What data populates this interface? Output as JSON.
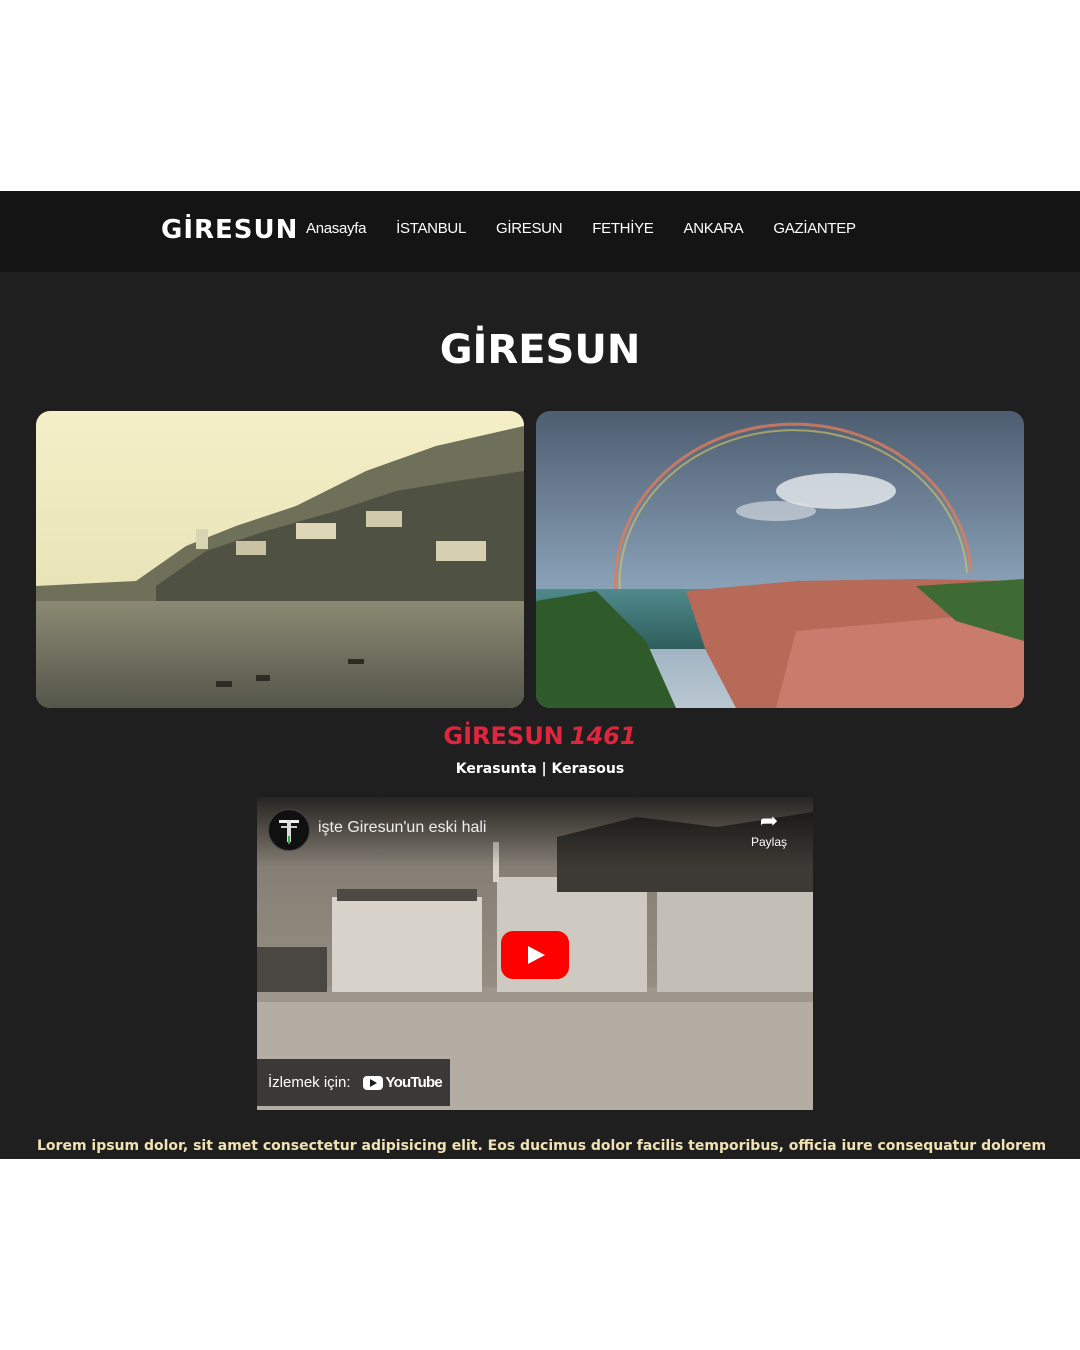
{
  "navbar": {
    "brand": "GİRESUN",
    "links": [
      "Anasayfa",
      "İSTANBUL",
      "GİRESUN",
      "FETHİYE",
      "ANKARA",
      "GAZİANTEP"
    ]
  },
  "main": {
    "title": "GİRESUN",
    "subtitle_city": "GİRESUN",
    "subtitle_year": "1461",
    "names": "Kerasunta | Kerasous",
    "paragraph": "Lorem ipsum dolor, sit amet consectetur adipisicing elit. Eos ducimus dolor facilis temporibus, officia iure consequatur dolorem,"
  },
  "video": {
    "title": "işte Giresun'un eski hali",
    "share_label": "Paylaş",
    "watch_label": "İzlemek için:",
    "youtube_label": "YouTube"
  },
  "colors": {
    "accent": "#e0253f",
    "background": "#1f1f1f",
    "navbar": "#141414",
    "paragraph": "#f1e2b4"
  },
  "icons": [
    "share-icon",
    "play-icon",
    "youtube-icon",
    "channel-avatar"
  ]
}
